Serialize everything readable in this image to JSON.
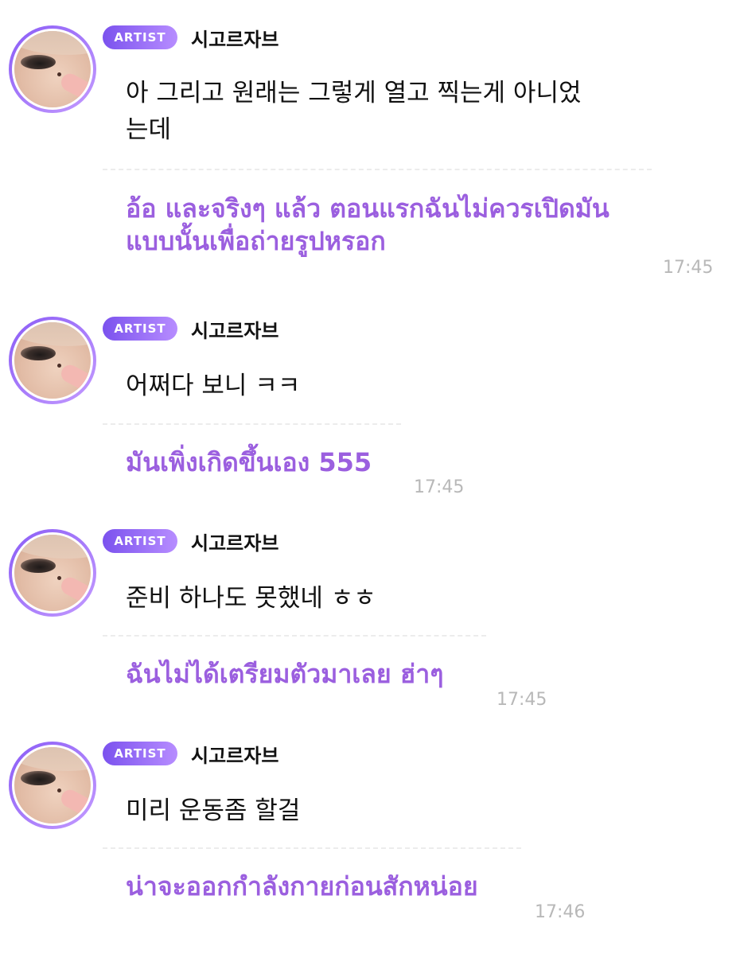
{
  "badge_label": "ARTIST",
  "colors": {
    "badge_start": "#7b52ee",
    "badge_end": "#b78dff",
    "translation_text": "#9b5fdf",
    "timestamp": "#b8b8b8"
  },
  "messages": [
    {
      "author": "시고르자브",
      "original_lines": [
        "아 그리고 원래는 그렇게 열고 찍는게 아니었",
        "는데"
      ],
      "translation_lines": [
        "อ้อ และจริงๆ แล้ว ตอนแรกฉันไม่ควรเปิดมัน",
        "แบบนั้นเพื่อถ่ายรูปหรอก"
      ],
      "time": "17:45"
    },
    {
      "author": "시고르자브",
      "original_lines": [
        "어쩌다 보니 ㅋㅋ"
      ],
      "translation_lines": [
        "มันเพิ่งเกิดขึ้นเอง 555"
      ],
      "time": "17:45"
    },
    {
      "author": "시고르자브",
      "original_lines": [
        "준비 하나도 못했네 ㅎㅎ"
      ],
      "translation_lines": [
        "ฉันไม่ได้เตรียมตัวมาเลย ฮ่าๆ"
      ],
      "time": "17:45"
    },
    {
      "author": "시고르자브",
      "original_lines": [
        "미리 운동좀 할걸"
      ],
      "translation_lines": [
        "น่าจะออกกำลังกายก่อนสักหน่อย"
      ],
      "time": "17:46"
    }
  ]
}
